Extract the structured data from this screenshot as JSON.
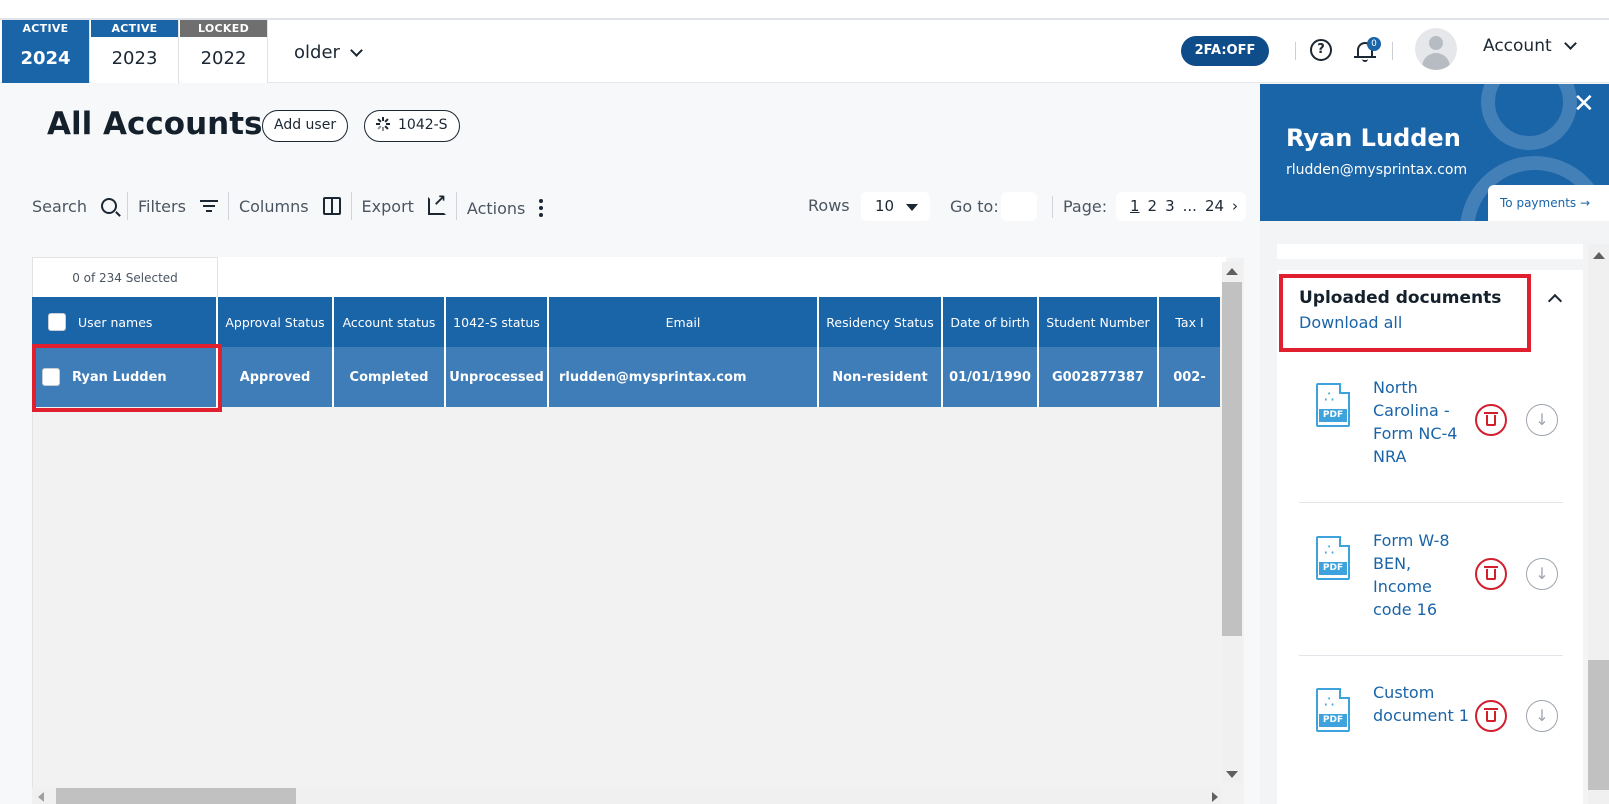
{
  "year_tabs": [
    {
      "status": "ACTIVE",
      "year": "2024"
    },
    {
      "status": "ACTIVE",
      "year": "2023"
    },
    {
      "status": "LOCKED",
      "year": "2022"
    }
  ],
  "older_label": "older",
  "header": {
    "twofa": "2FA:OFF",
    "help_glyph": "?",
    "notifications_count": "0",
    "account_label": "Account"
  },
  "main": {
    "title": "All Accounts",
    "add_user": "Add user",
    "form_filter": "1042-S"
  },
  "toolbar": {
    "search": "Search",
    "filters": "Filters",
    "columns": "Columns",
    "export": "Export",
    "actions": "Actions",
    "rows_label": "Rows",
    "rows_value": "10",
    "goto_label": "Go to:",
    "page_label": "Page:",
    "pages": [
      "1",
      "2",
      "3",
      "...",
      "24"
    ],
    "next_glyph": "›"
  },
  "table": {
    "selected_count": "0 of 234 Selected",
    "columns": [
      "User names",
      "Approval Status",
      "Account status",
      "1042-S status",
      "Email",
      "Residency Status",
      "Date of birth",
      "Student Number",
      "Tax I"
    ],
    "rows": [
      [
        "Ryan Ludden",
        "Approved",
        "Completed",
        "Unprocessed",
        "rludden@mysprintax.com",
        "Non-resident",
        "01/01/1990",
        "G002877387",
        "002-"
      ]
    ]
  },
  "panel": {
    "close_glyph": "✕",
    "name": "Ryan Ludden",
    "email": "rludden@mysprintax.com",
    "to_payments": "To payments →",
    "docs_title": "Uploaded documents",
    "download_all": "Download all",
    "pdf_label": "PDF",
    "documents": [
      {
        "name": "North Carolina - Form NC-4 NRA"
      },
      {
        "name": "Form W-8 BEN, Income code 16"
      },
      {
        "name": "Custom document 1"
      }
    ]
  },
  "colors": {
    "brand_blue": "#1a64a8",
    "row_blue": "#3f7db9",
    "highlight_red": "#e0202f",
    "delete_red": "#d21f2e",
    "pdf_blue": "#3ea3dc"
  }
}
